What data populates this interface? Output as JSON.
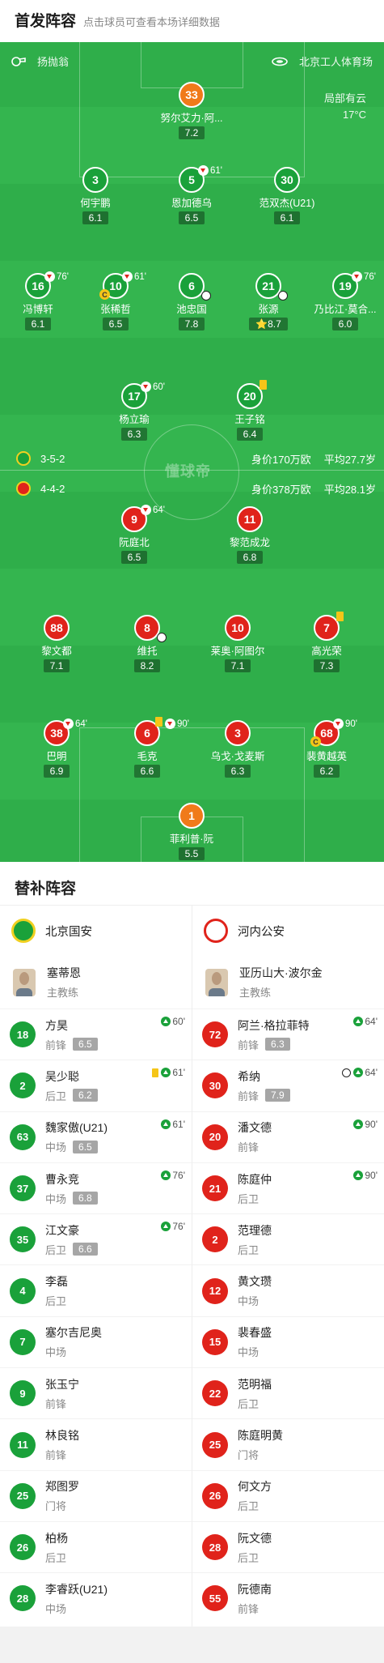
{
  "header": {
    "title": "首发阵容",
    "subtitle": "点击球员可查看本场详细数据"
  },
  "pitch_info": {
    "referee": "扬抛翁",
    "stadium": "北京工人体育场",
    "weather": "局部有云",
    "temperature": "17°C",
    "watermark": "懂球帝"
  },
  "home_info": {
    "formation": "3-5-2",
    "value": "身价170万欧",
    "age": "平均27.7岁",
    "badge_color": "#1aa13a"
  },
  "away_info": {
    "formation": "4-4-2",
    "value": "身价378万欧",
    "age": "平均28.1岁",
    "badge_color": "#e0231b"
  },
  "home_players": [
    {
      "num": "33",
      "name": "努尔艾力·阿...",
      "rating": "7.2",
      "gk": true
    },
    {
      "num": "3",
      "name": "何宇鹏",
      "rating": "6.1"
    },
    {
      "num": "5",
      "name": "恩加德乌",
      "rating": "6.5",
      "sub_out": "61'"
    },
    {
      "num": "30",
      "name": "范双杰(U21)",
      "rating": "6.1"
    },
    {
      "num": "16",
      "name": "冯博轩",
      "rating": "6.1",
      "sub_out": "76'"
    },
    {
      "num": "10",
      "name": "张稀哲",
      "rating": "6.5",
      "sub_out": "61'",
      "captain": "C"
    },
    {
      "num": "6",
      "name": "池忠国",
      "rating": "7.8",
      "ball": true
    },
    {
      "num": "21",
      "name": "张源",
      "rating": "8.7",
      "ball": true,
      "star": "⭐"
    },
    {
      "num": "19",
      "name": "乃比江·莫合...",
      "rating": "6.0",
      "sub_out": "76'"
    },
    {
      "num": "17",
      "name": "杨立瑜",
      "rating": "6.3",
      "sub_out": "60'"
    },
    {
      "num": "20",
      "name": "王子铭",
      "rating": "6.4",
      "yellow": true
    }
  ],
  "away_players": [
    {
      "num": "9",
      "name": "阮庭北",
      "rating": "6.5",
      "sub_out": "64'"
    },
    {
      "num": "11",
      "name": "黎范成龙",
      "rating": "6.8"
    },
    {
      "num": "88",
      "name": "黎文都",
      "rating": "7.1"
    },
    {
      "num": "8",
      "name": "维托",
      "rating": "8.2",
      "ball": true
    },
    {
      "num": "10",
      "name": "莱奥·阿图尔",
      "rating": "7.1"
    },
    {
      "num": "7",
      "name": "高光荣",
      "rating": "7.3",
      "yellow": true
    },
    {
      "num": "38",
      "name": "巴明",
      "rating": "6.9",
      "sub_out": "64'"
    },
    {
      "num": "6",
      "name": "毛克",
      "rating": "6.6",
      "sub_out": "90'",
      "yellow": true
    },
    {
      "num": "3",
      "name": "乌戈·戈麦斯",
      "rating": "6.3"
    },
    {
      "num": "68",
      "name": "裴黄越英",
      "rating": "6.2",
      "sub_out": "90'",
      "captain": "C"
    },
    {
      "num": "1",
      "name": "菲利普·阮",
      "rating": "5.5",
      "gk": true
    }
  ],
  "subs": {
    "title": "替补阵容",
    "home_team": "北京国安",
    "away_team": "河内公安",
    "home_coach": {
      "name": "塞蒂恩",
      "role": "主教练"
    },
    "away_coach": {
      "name": "亚历山大·波尔金",
      "role": "主教练"
    },
    "home": [
      {
        "num": "18",
        "name": "方昊",
        "pos": "前锋",
        "rating": "6.5",
        "in": "60'"
      },
      {
        "num": "2",
        "name": "吴少聪",
        "pos": "后卫",
        "rating": "6.2",
        "in": "61'",
        "yellow": true
      },
      {
        "num": "63",
        "name": "魏家傲(U21)",
        "pos": "中场",
        "rating": "6.5",
        "in": "61'"
      },
      {
        "num": "37",
        "name": "曹永竞",
        "pos": "中场",
        "rating": "6.8",
        "in": "76'"
      },
      {
        "num": "35",
        "name": "江文豪",
        "pos": "后卫",
        "rating": "6.6",
        "in": "76'"
      },
      {
        "num": "4",
        "name": "李磊",
        "pos": "后卫"
      },
      {
        "num": "7",
        "name": "塞尔吉尼奥",
        "pos": "中场"
      },
      {
        "num": "9",
        "name": "张玉宁",
        "pos": "前锋"
      },
      {
        "num": "11",
        "name": "林良铭",
        "pos": "前锋"
      },
      {
        "num": "25",
        "name": "郑图罗",
        "pos": "门将"
      },
      {
        "num": "26",
        "name": "柏杨",
        "pos": "后卫"
      },
      {
        "num": "28",
        "name": "李睿跃(U21)",
        "pos": "中场"
      }
    ],
    "away": [
      {
        "num": "72",
        "name": "阿兰·格拉菲特",
        "pos": "前锋",
        "rating": "6.3",
        "in": "64'"
      },
      {
        "num": "30",
        "name": "希纳",
        "pos": "前锋",
        "rating": "7.9",
        "in": "64'",
        "ball": true
      },
      {
        "num": "20",
        "name": "潘文德",
        "pos": "前锋",
        "in": "90'"
      },
      {
        "num": "21",
        "name": "陈庭仲",
        "pos": "后卫",
        "in": "90'"
      },
      {
        "num": "2",
        "name": "范理德",
        "pos": "后卫"
      },
      {
        "num": "12",
        "name": "黄文瓒",
        "pos": "中场"
      },
      {
        "num": "15",
        "name": "裴春盛",
        "pos": "中场"
      },
      {
        "num": "22",
        "name": "范明福",
        "pos": "后卫"
      },
      {
        "num": "25",
        "name": "陈庭明黄",
        "pos": "门将"
      },
      {
        "num": "26",
        "name": "何文方",
        "pos": "后卫"
      },
      {
        "num": "28",
        "name": "阮文德",
        "pos": "后卫"
      },
      {
        "num": "55",
        "name": "阮德南",
        "pos": "前锋"
      }
    ]
  }
}
